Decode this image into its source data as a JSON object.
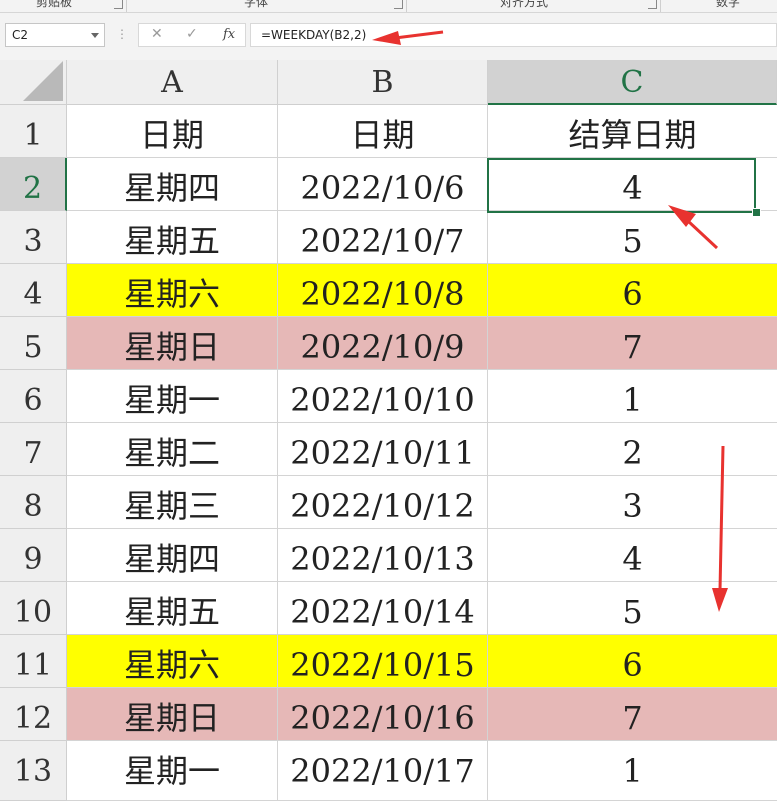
{
  "ribbon": {
    "groups": [
      "剪贴板",
      "字体",
      "对齐方式",
      "数字"
    ]
  },
  "formula_bar": {
    "name_box": "C2",
    "cancel_icon": "close-icon",
    "enter_icon": "check-icon",
    "fx_label": "fx",
    "formula": "=WEEKDAY(B2,2)"
  },
  "sheet": {
    "columns": [
      "A",
      "B",
      "C"
    ],
    "selected_cell": "C2",
    "rows": [
      {
        "num": "1",
        "a": "日期",
        "b": "日期",
        "c": "结算日期",
        "fill": "none"
      },
      {
        "num": "2",
        "a": "星期四",
        "b": "2022/10/6",
        "c": "4",
        "fill": "none"
      },
      {
        "num": "3",
        "a": "星期五",
        "b": "2022/10/7",
        "c": "5",
        "fill": "none"
      },
      {
        "num": "4",
        "a": "星期六",
        "b": "2022/10/8",
        "c": "6",
        "fill": "yellow"
      },
      {
        "num": "5",
        "a": "星期日",
        "b": "2022/10/9",
        "c": "7",
        "fill": "pink"
      },
      {
        "num": "6",
        "a": "星期一",
        "b": "2022/10/10",
        "c": "1",
        "fill": "none"
      },
      {
        "num": "7",
        "a": "星期二",
        "b": "2022/10/11",
        "c": "2",
        "fill": "none"
      },
      {
        "num": "8",
        "a": "星期三",
        "b": "2022/10/12",
        "c": "3",
        "fill": "none"
      },
      {
        "num": "9",
        "a": "星期四",
        "b": "2022/10/13",
        "c": "4",
        "fill": "none"
      },
      {
        "num": "10",
        "a": "星期五",
        "b": "2022/10/14",
        "c": "5",
        "fill": "none"
      },
      {
        "num": "11",
        "a": "星期六",
        "b": "2022/10/15",
        "c": "6",
        "fill": "yellow"
      },
      {
        "num": "12",
        "a": "星期日",
        "b": "2022/10/16",
        "c": "7",
        "fill": "pink"
      },
      {
        "num": "13",
        "a": "星期一",
        "b": "2022/10/17",
        "c": "1",
        "fill": "none"
      }
    ]
  },
  "colors": {
    "yellow": "#ffff00",
    "pink": "#e6b8b7",
    "accent": "#217346",
    "annotation": "#e8322f"
  }
}
